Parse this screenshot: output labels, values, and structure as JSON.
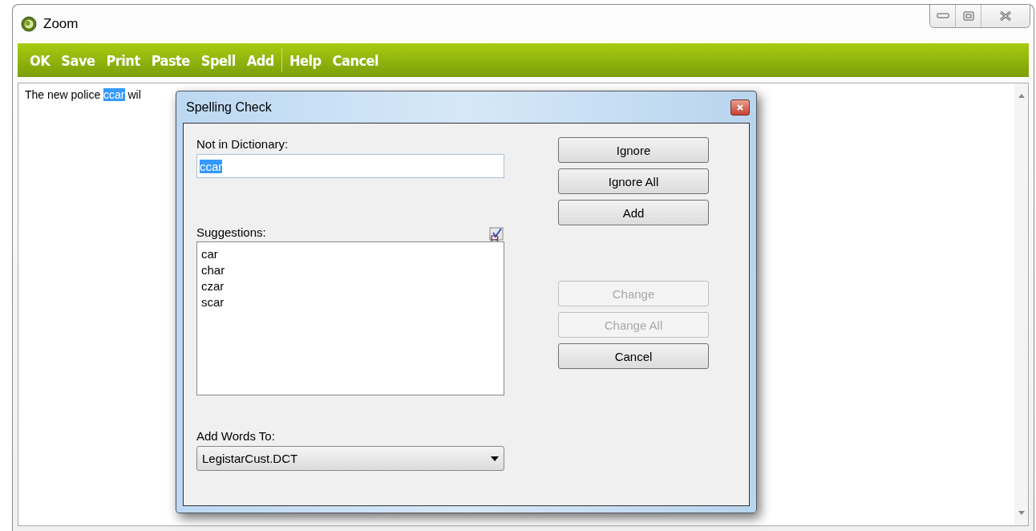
{
  "window": {
    "title": "Zoom"
  },
  "toolbar": {
    "groups": [
      [
        "OK",
        "Save",
        "Print",
        "Paste",
        "Spell",
        "Add"
      ],
      [
        "Help",
        "Cancel"
      ]
    ]
  },
  "editor": {
    "text_before": "The new police ",
    "selected_text": "ccar",
    "text_after": "wil"
  },
  "dialog": {
    "title": "Spelling Check",
    "not_in_dictionary": {
      "label": "Not in Dictionary:",
      "value": "ccar"
    },
    "suggestions": {
      "label": "Suggestions:",
      "items": [
        "car",
        "char",
        "czar",
        "scar"
      ]
    },
    "add_words_to": {
      "label": "Add Words To:",
      "value": "LegistarCust.DCT"
    },
    "button_groups": [
      [
        {
          "label": "Ignore",
          "disabled": false
        },
        {
          "label": "Ignore All",
          "disabled": false
        },
        {
          "label": "Add",
          "disabled": false
        }
      ],
      [
        {
          "label": "Change",
          "disabled": true
        },
        {
          "label": "Change All",
          "disabled": true
        },
        {
          "label": "Cancel",
          "disabled": false
        }
      ]
    ]
  }
}
